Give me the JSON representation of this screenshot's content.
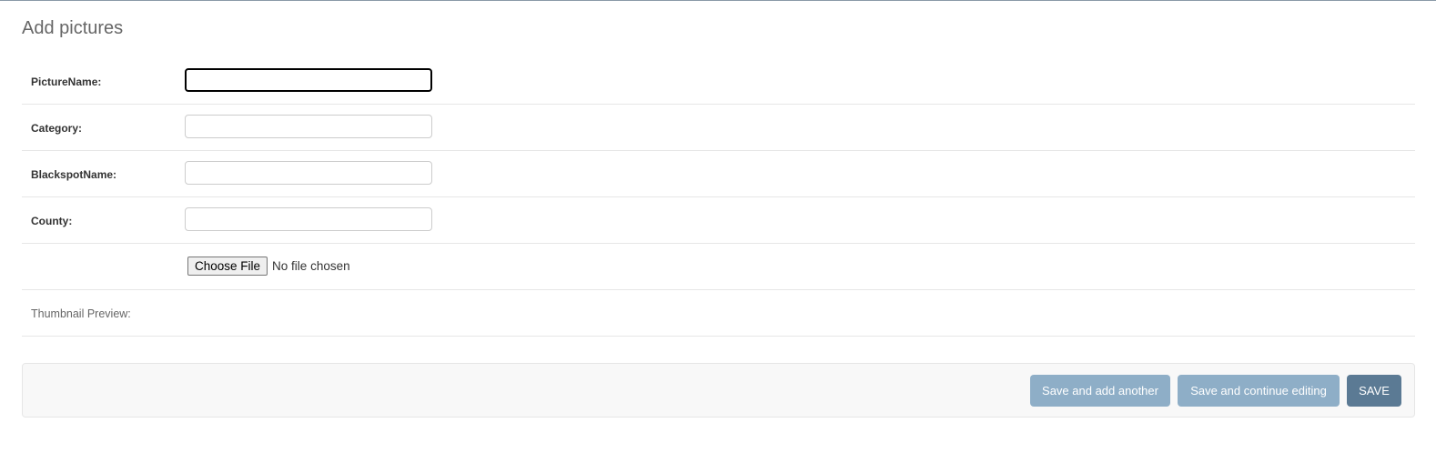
{
  "page": {
    "title": "Add pictures"
  },
  "form": {
    "fields": [
      {
        "label": "PictureName:",
        "value": ""
      },
      {
        "label": "Category:",
        "value": ""
      },
      {
        "label": "BlackspotName:",
        "value": ""
      },
      {
        "label": "County:",
        "value": ""
      }
    ],
    "file": {
      "button_label": "Choose File",
      "status": "No file chosen"
    },
    "thumbnail_label": "Thumbnail Preview:"
  },
  "actions": {
    "save_add_another": "Save and add another",
    "save_continue": "Save and continue editing",
    "save": "SAVE"
  },
  "colors": {
    "secondary_button": "#8eaec7",
    "primary_button": "#5b7a94"
  }
}
